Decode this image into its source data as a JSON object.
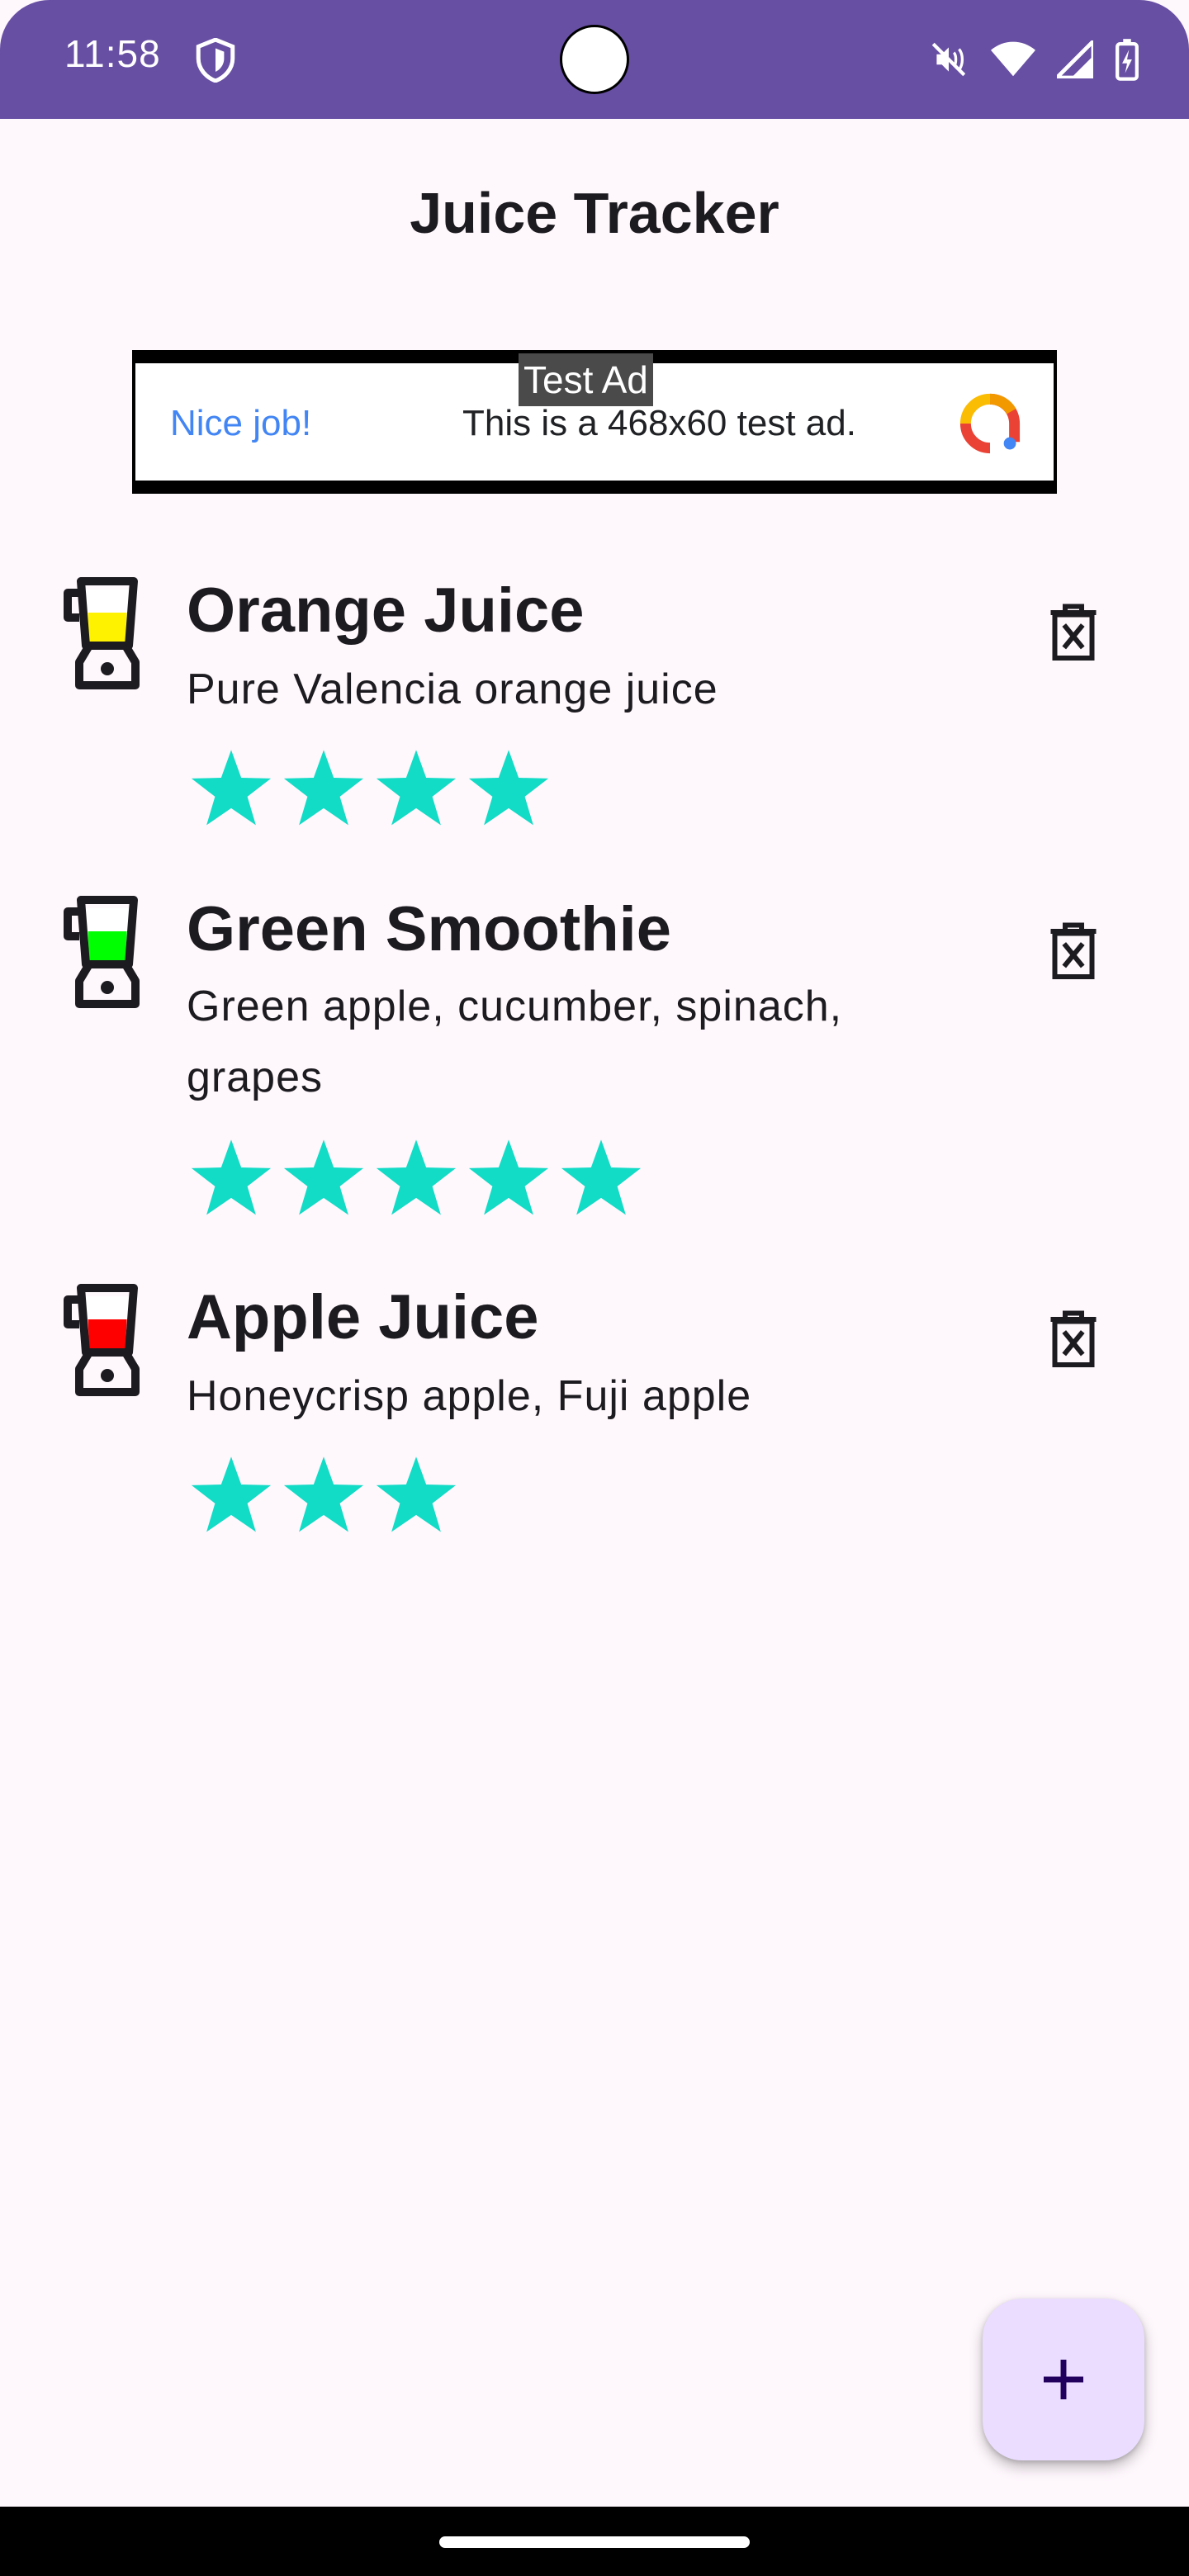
{
  "status_bar": {
    "time": "11:58",
    "icons": [
      "shield-icon",
      "mute-icon",
      "wifi-icon",
      "signal-icon",
      "battery-charging-icon"
    ],
    "color": "#674FA3"
  },
  "app": {
    "title": "Juice Tracker"
  },
  "ad": {
    "label": "Test Ad",
    "headline": "Nice job!",
    "text": "This is a 468x60 test ad."
  },
  "juices": [
    {
      "name": "Orange Juice",
      "description": "Pure Valencia orange juice",
      "rating": 4,
      "color": "#FFF200",
      "icon": "blender-icon"
    },
    {
      "name": "Green Smoothie",
      "description": "Green apple, cucumber, spinach, grapes",
      "rating": 5,
      "color": "#00FF00",
      "icon": "blender-icon"
    },
    {
      "name": "Apple Juice",
      "description": "Honeycrisp apple, Fuji apple",
      "rating": 3,
      "color": "#FF0000",
      "icon": "blender-icon"
    }
  ],
  "colors": {
    "star": "#12DBC6",
    "fab_bg": "#EADDFF",
    "fab_icon": "#21005D",
    "ad_accent": "#4285F4"
  },
  "fab": {
    "icon": "plus-icon"
  }
}
